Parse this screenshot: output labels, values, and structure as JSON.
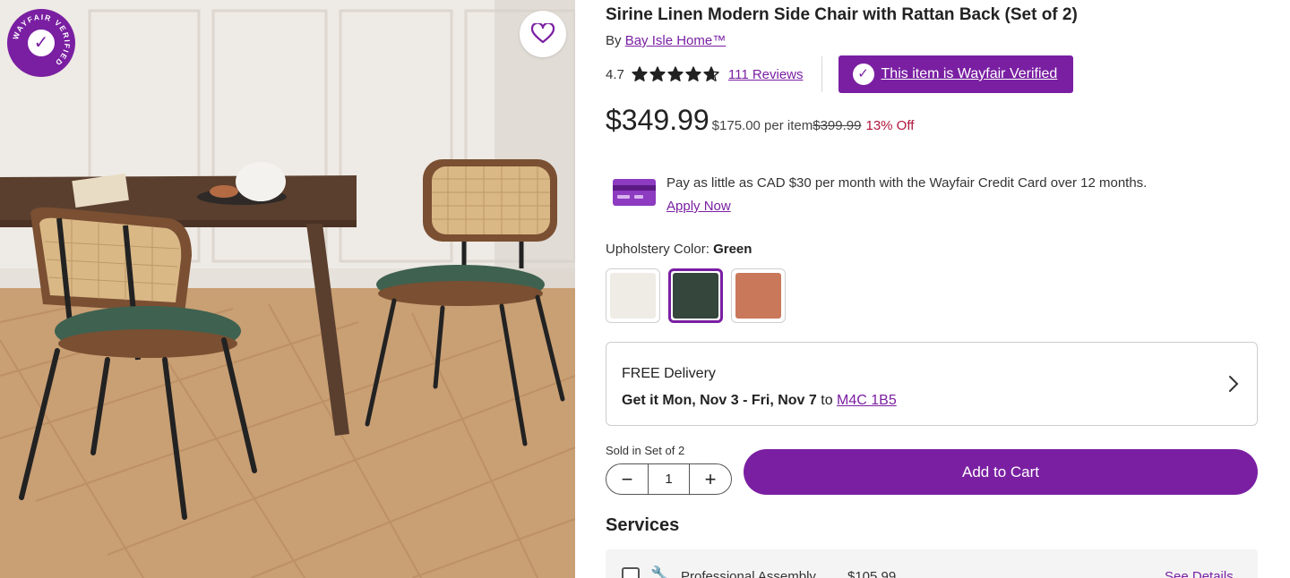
{
  "gallery": {
    "seal_text": "WAYFAIR VERIFIED",
    "favorite_icon": "heart-outline-icon"
  },
  "product": {
    "title": "Sirine Linen Modern Side Chair with Rattan Back (Set of 2)",
    "by_prefix": "By",
    "brand": "Bay Isle Home™",
    "rating": "4.7",
    "rating_value": 4.7,
    "rating_max": 5,
    "reviews_link": "111 Reviews",
    "verified_label": "This item is Wayfair Verified"
  },
  "pricing": {
    "price": "$349.99",
    "per_item": "$175.00 per item",
    "was_price": "$399.99",
    "discount": "13% Off"
  },
  "credit": {
    "text": "Pay as little as CAD $30 per month with the Wayfair Credit Card over 12 months.",
    "apply_link": "Apply Now"
  },
  "upholstery": {
    "label": "Upholstery Color:",
    "selected": "Green",
    "swatches": [
      {
        "name": "Cream",
        "color": "#efece6",
        "selected": false
      },
      {
        "name": "Green",
        "color": "#35463c",
        "selected": true
      },
      {
        "name": "Terracotta",
        "color": "#c9785a",
        "selected": false
      }
    ]
  },
  "delivery": {
    "title": "FREE Delivery",
    "eta_prefix": "Get it Mon, Nov 3 - Fri, Nov 7",
    "eta_to": "to",
    "postal_code": "M4C 1B5"
  },
  "cart": {
    "sold_in_set": "Sold in Set of 2",
    "quantity": "1",
    "minus": "−",
    "plus": "+",
    "add_to_cart": "Add to Cart"
  },
  "services": {
    "title": "Services",
    "item_label": "Professional Assembly",
    "item_price": "$105.99",
    "details_link": "See Details"
  },
  "colors": {
    "brand_purple": "#7a1fa2",
    "sale_red": "#b0163c"
  }
}
